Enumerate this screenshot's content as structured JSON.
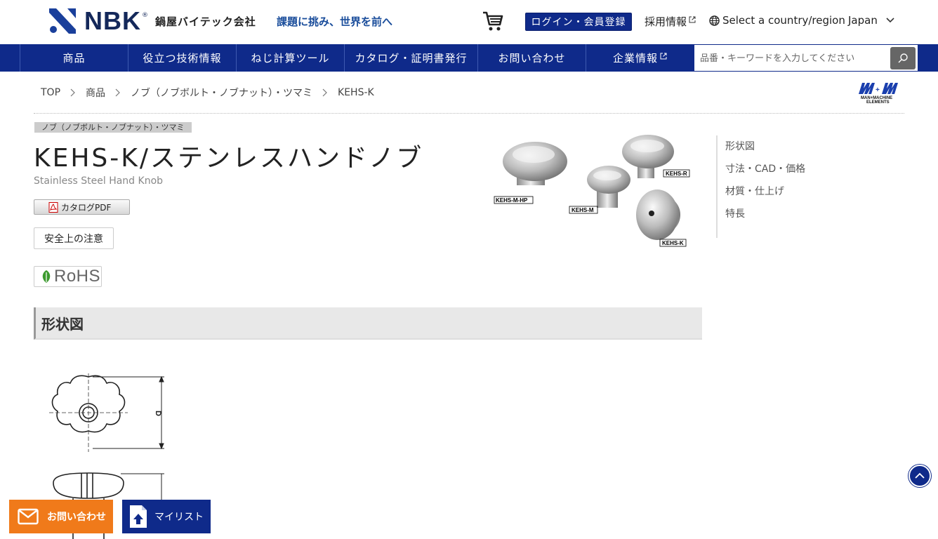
{
  "header": {
    "brand": "NBK",
    "brand_reg": "®",
    "brand_jp": "鍋屋バイテック会社",
    "tagline": "課題に挑み、世界を前へ",
    "login_label": "ログイン・会員登録",
    "recruit_label": "採用情報",
    "country_label": "Select a country/region",
    "language": "Japan"
  },
  "nav": {
    "items": [
      {
        "label": "商品",
        "width": 182
      },
      {
        "label": "役立つ技術情報",
        "width": 154
      },
      {
        "label": "ねじ計算ツール",
        "width": 154
      },
      {
        "label": "カタログ・証明書発行",
        "width": 190
      },
      {
        "label": "お問い合わせ",
        "width": 154
      },
      {
        "label": "企業情報",
        "width": 154
      }
    ],
    "search_placeholder": "品番・キーワードを入力してください"
  },
  "breadcrumb": [
    "TOP",
    "商品",
    "ノブ（ノブボルト・ノブナット）・ツマミ",
    "KEHS-K"
  ],
  "brand_partner": {
    "line1": "MAN+MACHINE",
    "line2": "ELEMENTS"
  },
  "product": {
    "category_tag": "ノブ（ノブボルト・ノブナット）・ツマミ",
    "title": "KEHS-K/ステンレスハンドノブ",
    "subtitle": "Stainless Steel Hand Knob",
    "catalog_pdf_label": "カタログPDF",
    "safety_label": "安全上の注意",
    "rohs_label": "RoHS",
    "image_labels": [
      "KEHS-M-HP",
      "KEHS-M",
      "KEHS-R",
      "KEHS-K"
    ]
  },
  "side_menu": [
    "形状図",
    "寸法・CAD・価格",
    "材質・仕上げ",
    "特長"
  ],
  "section": {
    "heading": "形状図",
    "dimension_label": "D"
  },
  "floating": {
    "contact_label": "お問い合わせ",
    "mylist_label": "マイリスト"
  },
  "colors": {
    "brand_blue": "#0f2a8a",
    "contact_orange": "#f07a1a",
    "tagline_blue": "#1a4d9b"
  }
}
